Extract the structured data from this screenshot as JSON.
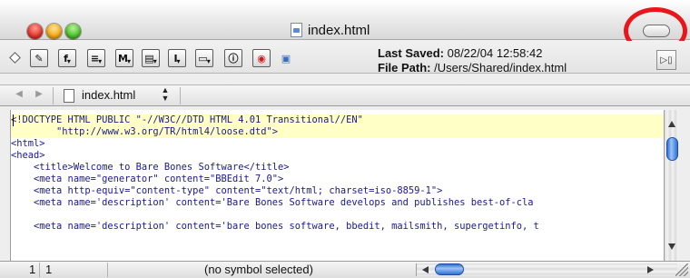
{
  "window": {
    "title": "index.html",
    "file_icon": "html-file-icon",
    "toolbar_toggle_icon": "toolbar-toggle-pill-icon",
    "annotation_color": "#e8171b"
  },
  "toolbar": {
    "buttons": [
      {
        "name": "pencil-button",
        "glyph": "✎"
      },
      {
        "name": "function-button",
        "glyph": "f"
      },
      {
        "name": "list-button",
        "glyph": "≡"
      },
      {
        "name": "marker-button",
        "glyph": "M"
      },
      {
        "name": "document-button",
        "glyph": "▤"
      },
      {
        "name": "text-cursor-button",
        "glyph": "I"
      },
      {
        "name": "window-button",
        "glyph": "▭"
      },
      {
        "name": "info-button",
        "glyph": "ⓘ"
      },
      {
        "name": "preview-button",
        "glyph": "◉"
      },
      {
        "name": "file-button",
        "glyph": "▣"
      }
    ],
    "last_saved_label": "Last Saved:",
    "last_saved_value": "08/22/04 12:58:42",
    "file_path_label": "File Path:",
    "file_path_value": "/Users/Shared/index.html"
  },
  "navbar": {
    "back_glyph": "◀",
    "forward_glyph": "▶",
    "current_file": "index.html",
    "updown_up": "▲",
    "updown_down": "▼"
  },
  "editor": {
    "lines": [
      {
        "text": "<!DOCTYPE HTML PUBLIC \"-//W3C//DTD HTML 4.01 Transitional//EN\"",
        "highlight": true
      },
      {
        "text": "        \"http://www.w3.org/TR/html4/loose.dtd\">",
        "highlight": true
      },
      {
        "text": "<html>",
        "highlight": false
      },
      {
        "text": "<head>",
        "highlight": false
      },
      {
        "text": "    <title>Welcome to Bare Bones Software</title>",
        "highlight": false
      },
      {
        "text": "    <meta name=\"generator\" content=\"BBEdit 7.0\">",
        "highlight": false
      },
      {
        "text": "    <meta http-equiv=\"content-type\" content=\"text/html; charset=iso-8859-1\">",
        "highlight": false
      },
      {
        "text": "    <meta name='description' content='Bare Bones Software develops and publishes best-of-cla",
        "highlight": false
      },
      {
        "text": "",
        "highlight": false
      },
      {
        "text": "    <meta name='description' content='bare bones software, bbedit, mailsmith, supergetinfo, t",
        "highlight": false
      }
    ]
  },
  "statusbar": {
    "line": "1",
    "column": "1",
    "symbol": "(no symbol selected)"
  }
}
